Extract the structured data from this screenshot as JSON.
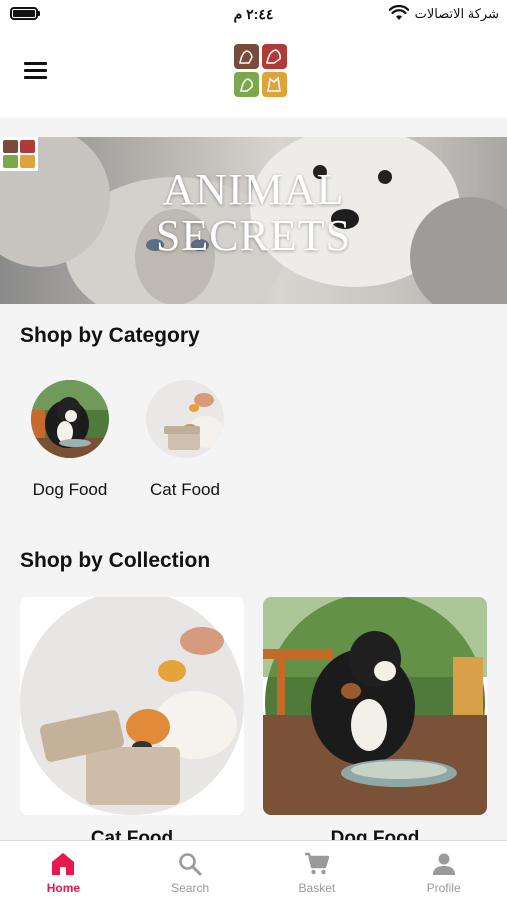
{
  "status_bar": {
    "time": "٢:٤٤ م",
    "carrier": "شركة الاتصالات",
    "wifi_icon": "wifi-icon",
    "battery_icon": "battery-icon"
  },
  "header": {
    "menu_icon": "hamburger-menu-icon",
    "logo_icon": "app-logo-icon",
    "logo_colors": [
      "#7a4a3a",
      "#b03a3a",
      "#7aa84a",
      "#e0a23a"
    ]
  },
  "banner": {
    "title_line1": "ANIMAL",
    "title_line2": "SECRETS"
  },
  "categories": {
    "title": "Shop by Category",
    "items": [
      {
        "label": "Dog Food"
      },
      {
        "label": "Cat Food"
      }
    ]
  },
  "collections": {
    "title": "Shop by Collection",
    "items": [
      {
        "label": "Cat Food"
      },
      {
        "label": "Dog Food"
      }
    ]
  },
  "tab_bar": {
    "accent_color": "#e8184a",
    "tabs": [
      {
        "label": "Home",
        "icon": "home-icon",
        "active": true
      },
      {
        "label": "Search",
        "icon": "search-icon",
        "active": false
      },
      {
        "label": "Basket",
        "icon": "basket-icon",
        "active": false
      },
      {
        "label": "Profile",
        "icon": "profile-icon",
        "active": false
      }
    ]
  }
}
